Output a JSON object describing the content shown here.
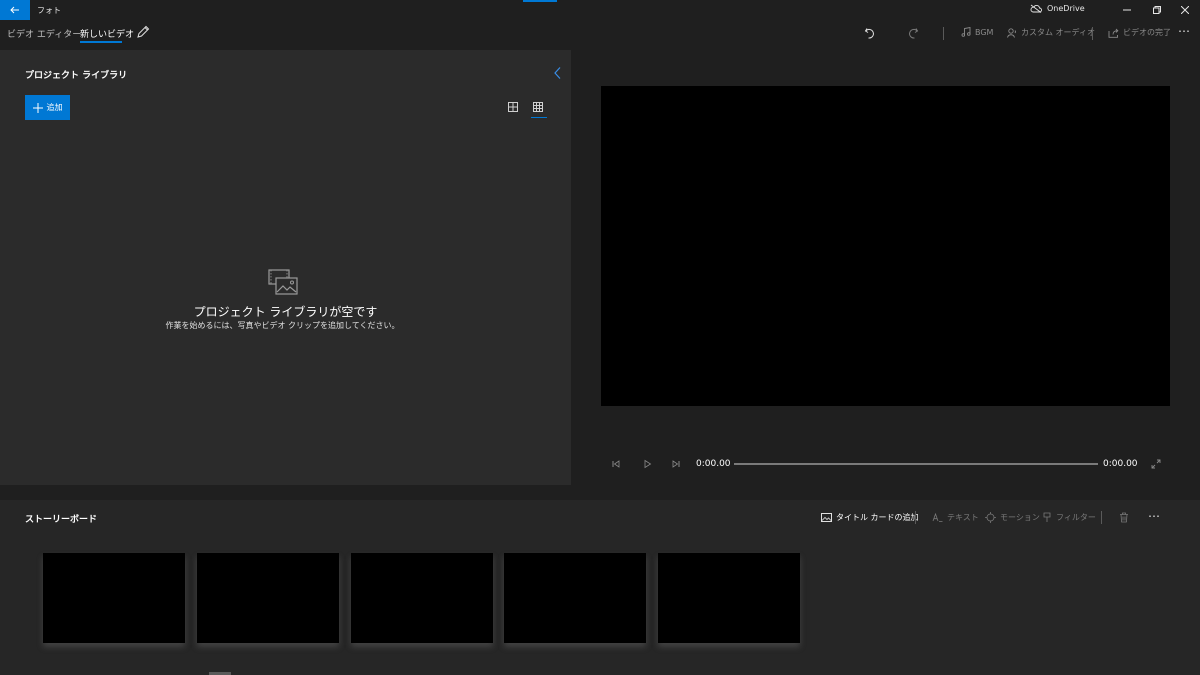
{
  "titlebar": {
    "back_icon": "arrow-left-icon",
    "app_title": "フォト",
    "cloud_icon": "cloud-off-icon",
    "cloud_label": "OneDrive",
    "minimize_icon": "minimize-icon",
    "restore_icon": "restore-icon",
    "close_icon": "close-icon"
  },
  "toolbar": {
    "breadcrumb_root": "ビデオ エディター",
    "breadcrumb_separator": "›",
    "breadcrumb_current": "新しいビデオ",
    "rename_icon": "pencil-icon",
    "undo_icon": "undo-icon",
    "redo_icon": "redo-icon",
    "bgm_label": "BGM",
    "bgm_icon": "music-note-icon",
    "custom_audio_label": "カスタム オーディオ",
    "custom_audio_icon": "audio-person-icon",
    "finish_video_label": "ビデオの完了",
    "finish_video_icon": "share-icon",
    "more_label": "⋯"
  },
  "library": {
    "title": "プロジェクト ライブラリ",
    "collapse_icon": "chevron-left-icon",
    "add_label": "追加",
    "add_icon": "plus-icon",
    "view_large_icon": "grid-large-icon",
    "view_small_icon": "grid-small-icon",
    "empty_icon": "photos-empty-icon",
    "empty_title": "プロジェクト ライブラリが空です",
    "empty_subtitle": "作業を始めるには、写真やビデオ クリップを追加してください。"
  },
  "player": {
    "time_current": "0:00.00",
    "time_total": "0:00.00",
    "progress": 0,
    "prev_icon": "step-back-icon",
    "play_icon": "play-icon",
    "next_icon": "step-forward-icon",
    "fullscreen_icon": "fullscreen-icon"
  },
  "storyboard": {
    "title": "ストーリーボード",
    "title_card_label": "タイトル カードの追加",
    "title_card_icon": "image-icon",
    "text_label": "テキスト",
    "text_icon": "text-icon",
    "motion_label": "モーション",
    "motion_icon": "motion-icon",
    "filter_label": "フィルター",
    "filter_icon": "filter-icon",
    "delete_icon": "trash-icon",
    "more_label": "⋯",
    "slot_count": 5
  },
  "colors": {
    "accent": "#0078d4",
    "library_bg": "#2b2b2b",
    "app_bg": "#1f1f1f",
    "storyboard_bg": "#262626"
  }
}
